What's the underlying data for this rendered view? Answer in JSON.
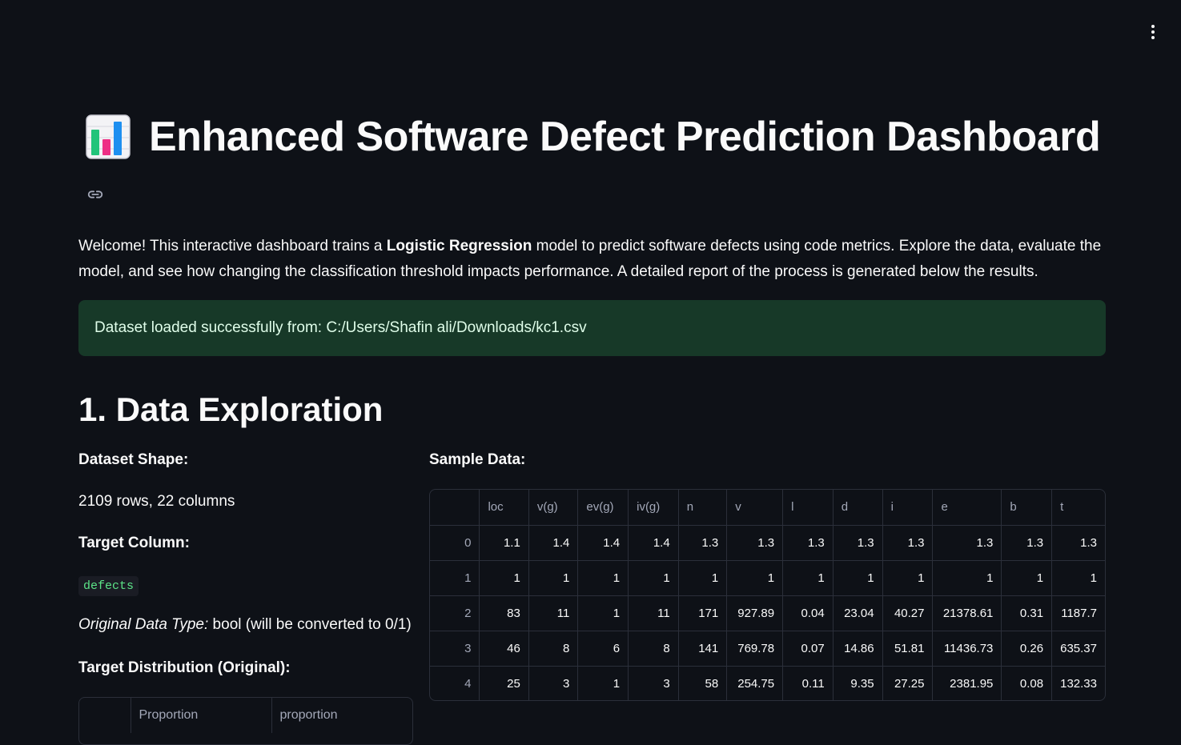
{
  "header": {
    "menu_icon": "vertical-dots-icon"
  },
  "title": {
    "icon": "bar-chart-emoji-icon",
    "text": "Enhanced Software Defect Prediction Dashboard"
  },
  "intro": {
    "part1": "Welcome! This interactive dashboard trains a ",
    "bold": "Logistic Regression",
    "part2": " model to predict software defects using code metrics. Explore the data, evaluate the model, and see how changing the classification threshold impacts performance. A detailed report of the process is generated below the results."
  },
  "success_message": "Dataset loaded successfully from: C:/Users/Shafin ali/Downloads/kc1.csv",
  "section1": {
    "heading": "1. Data Exploration",
    "dataset_shape_label": "Dataset Shape:",
    "dataset_shape_value": "2109 rows, 22 columns",
    "target_column_label": "Target Column:",
    "target_column_value": "defects",
    "dtype_label": "Original Data Type:",
    "dtype_value": " bool (will be converted to 0/1)",
    "distribution_label": "Target Distribution (Original):",
    "distribution_columns": [
      "",
      "Proportion",
      "proportion"
    ],
    "sample_label": "Sample Data:"
  },
  "sample_table": {
    "columns": [
      "",
      "loc",
      "v(g)",
      "ev(g)",
      "iv(g)",
      "n",
      "v",
      "l",
      "d",
      "i",
      "e",
      "b",
      "t"
    ],
    "rows": [
      [
        "0",
        "1.1",
        "1.4",
        "1.4",
        "1.4",
        "1.3",
        "1.3",
        "1.3",
        "1.3",
        "1.3",
        "1.3",
        "1.3",
        "1.3"
      ],
      [
        "1",
        "1",
        "1",
        "1",
        "1",
        "1",
        "1",
        "1",
        "1",
        "1",
        "1",
        "1",
        "1"
      ],
      [
        "2",
        "83",
        "11",
        "1",
        "11",
        "171",
        "927.89",
        "0.04",
        "23.04",
        "40.27",
        "21378.61",
        "0.31",
        "1187.7"
      ],
      [
        "3",
        "46",
        "8",
        "6",
        "8",
        "141",
        "769.78",
        "0.07",
        "14.86",
        "51.81",
        "11436.73",
        "0.26",
        "635.37"
      ],
      [
        "4",
        "25",
        "3",
        "1",
        "3",
        "58",
        "254.75",
        "0.11",
        "9.35",
        "27.25",
        "2381.95",
        "0.08",
        "132.33"
      ]
    ]
  }
}
